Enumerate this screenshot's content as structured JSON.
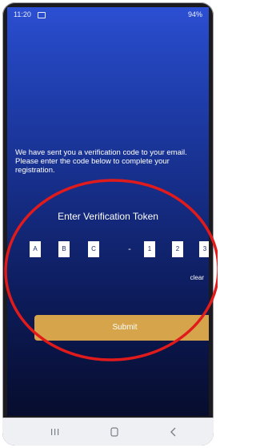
{
  "status_bar": {
    "time": "11:20",
    "right_status": "94%"
  },
  "verification": {
    "message": "We have sent you a verification code to your email. Please enter the code below to complete your registration.",
    "title": "Enter Verification Token",
    "code": [
      "A",
      "B",
      "C",
      "1",
      "2",
      "3"
    ],
    "separator": "-",
    "clear_label": "clear",
    "submit_label": "Submit"
  },
  "colors": {
    "background_top": "#2c4fd3",
    "background_bottom": "#070d2d",
    "submit_button": "#d6a44a",
    "highlight": "#e11b1b"
  },
  "icons": {
    "nav_left": "recent-apps-icon",
    "nav_center": "home-icon",
    "nav_right": "back-icon"
  }
}
